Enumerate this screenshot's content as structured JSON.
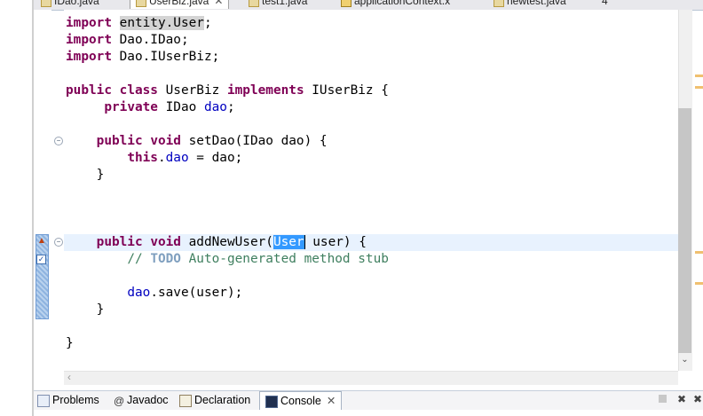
{
  "editor_tabs": [
    {
      "label": "IDao.java",
      "active": false
    },
    {
      "label": "UserBiz.java",
      "active": true
    },
    {
      "label": "test1.java",
      "active": false
    },
    {
      "label": "applicationContext.x",
      "active": false
    },
    {
      "label": "newtest.java",
      "active": false
    }
  ],
  "overflow_count": "4",
  "code": {
    "l1": {
      "kw": "import",
      "occ": "entity.User",
      "rest": ";"
    },
    "l2": {
      "kw": "import",
      "rest": " Dao.IDao;"
    },
    "l3": {
      "kw": "import",
      "rest": " Dao.IUserBiz;"
    },
    "l4": {
      "kw1": "public",
      "kw2": "class",
      "name": " UserBiz ",
      "kw3": "implements",
      "rest": " IUserBiz {"
    },
    "l5": {
      "kw": "private",
      "type": " IDao ",
      "fld": "dao",
      "rest": ";"
    },
    "l6": {
      "kw1": "public",
      "kw2": "void",
      "rest": " setDao(IDao dao) {"
    },
    "l7": {
      "kw": "this",
      "dot": ".",
      "fld": "dao",
      "rest": " = dao;"
    },
    "l8": {
      "rest": "}"
    },
    "l9": {
      "kw1": "public",
      "kw2": "void",
      "pre": " addNewUser(",
      "sel": "User",
      "rest": " user) {"
    },
    "l10": {
      "c1": "// ",
      "todo": "TODO",
      "c2": " Auto-generated method stub"
    },
    "l11": {
      "fld": "dao",
      "rest": ".save(user);"
    },
    "l12": {
      "rest": "}"
    },
    "l13": {
      "rest": "}"
    }
  },
  "bottom_tabs": [
    {
      "label": "Problems",
      "icon": "problems-icon"
    },
    {
      "label": "Javadoc",
      "icon": "at-icon"
    },
    {
      "label": "Declaration",
      "icon": "declaration-icon"
    },
    {
      "label": "Console",
      "icon": "console-icon",
      "active": true
    }
  ],
  "colors": {
    "keyword": "#7f0055",
    "field": "#0000c0",
    "comment": "#3f7f5f",
    "selection": "#3399ff"
  }
}
